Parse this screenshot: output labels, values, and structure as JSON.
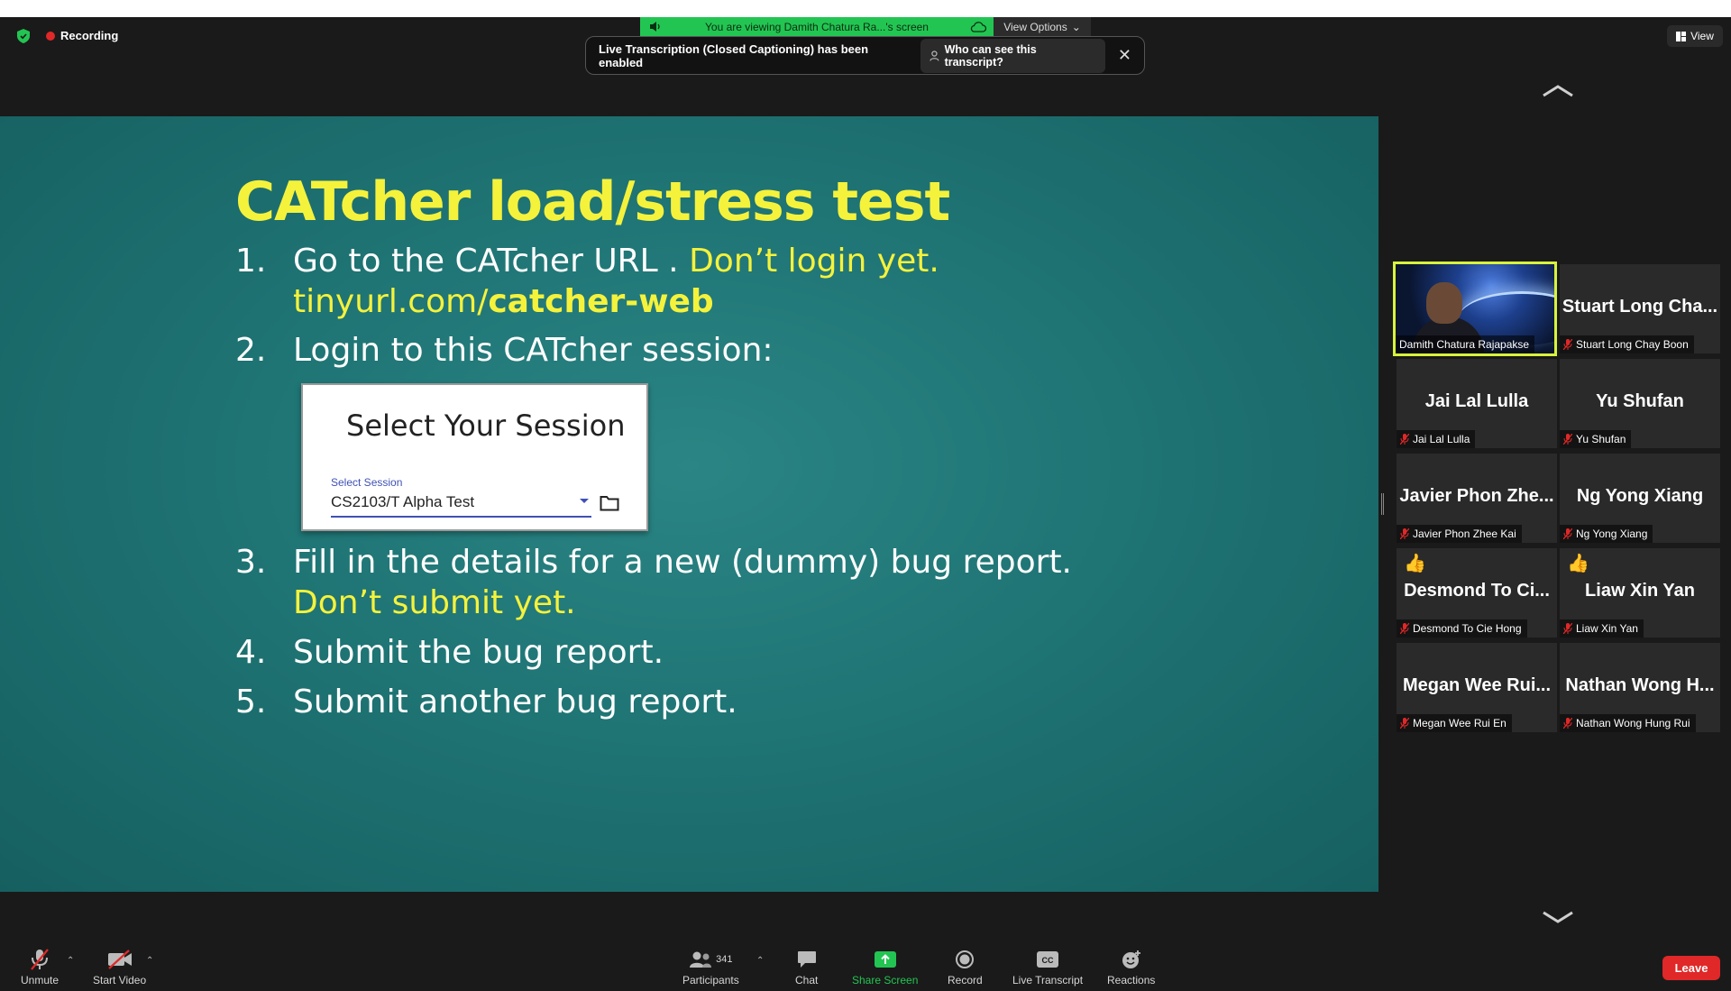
{
  "meeting": {
    "recording_label": "Recording",
    "viewing_banner": "You are viewing Damith Chatura Ra...'s screen",
    "view_options": "View Options",
    "transcript_notice": "Live Transcription (Closed Captioning) has been enabled",
    "transcript_who": "Who can see this transcript?",
    "view_button": "View"
  },
  "slide": {
    "title": "CATcher load/stress test",
    "steps": [
      {
        "num": "1.",
        "text": "Go to the CATcher URL . ",
        "highlight": "Don’t login yet.",
        "cont_prefix": "tinyurl.com/",
        "cont_bold": "catcher-web"
      },
      {
        "num": "2.",
        "text": "Login to this CATcher session:"
      },
      {
        "num": "3.",
        "text": "Fill in the details for a new (dummy) bug report.",
        "cont": "Don’t submit yet."
      },
      {
        "num": "4.",
        "text": "Submit the bug report."
      },
      {
        "num": "5.",
        "text": "Submit another bug report."
      }
    ],
    "session_card": {
      "title": "Select Your Session",
      "field_label": "Select Session",
      "field_value": "CS2103/T Alpha Test"
    }
  },
  "participants": [
    {
      "display": "",
      "label": "Damith Chatura Rajapakse",
      "video": true,
      "muted": false,
      "reaction": ""
    },
    {
      "display": "Stuart Long Cha...",
      "label": "Stuart Long Chay Boon",
      "video": false,
      "muted": true,
      "reaction": ""
    },
    {
      "display": "Jai Lal Lulla",
      "label": "Jai Lal Lulla",
      "video": false,
      "muted": true,
      "reaction": ""
    },
    {
      "display": "Yu Shufan",
      "label": "Yu Shufan",
      "video": false,
      "muted": true,
      "reaction": ""
    },
    {
      "display": "Javier Phon Zhe...",
      "label": "Javier Phon Zhee Kai",
      "video": false,
      "muted": true,
      "reaction": ""
    },
    {
      "display": "Ng Yong Xiang",
      "label": "Ng Yong Xiang",
      "video": false,
      "muted": true,
      "reaction": ""
    },
    {
      "display": "Desmond To Ci...",
      "label": "Desmond To Cie Hong",
      "video": false,
      "muted": true,
      "reaction": "👍"
    },
    {
      "display": "Liaw Xin Yan",
      "label": "Liaw Xin Yan",
      "video": false,
      "muted": true,
      "reaction": "👍"
    },
    {
      "display": "Megan Wee Rui...",
      "label": "Megan Wee Rui En",
      "video": false,
      "muted": true,
      "reaction": ""
    },
    {
      "display": "Nathan Wong H...",
      "label": "Nathan Wong Hung Rui",
      "video": false,
      "muted": true,
      "reaction": ""
    }
  ],
  "toolbar": {
    "unmute": "Unmute",
    "start_video": "Start Video",
    "participants": "Participants",
    "participant_count": "341",
    "chat": "Chat",
    "share_screen": "Share Screen",
    "record": "Record",
    "live_transcript": "Live Transcript",
    "reactions": "Reactions",
    "leave": "Leave"
  },
  "colors": {
    "slide_bg": "#1f7474",
    "highlight_yellow": "#f5f23c",
    "active_speaker_border": "#d8f33b",
    "share_green": "#23c552",
    "leave_red": "#e02828"
  }
}
